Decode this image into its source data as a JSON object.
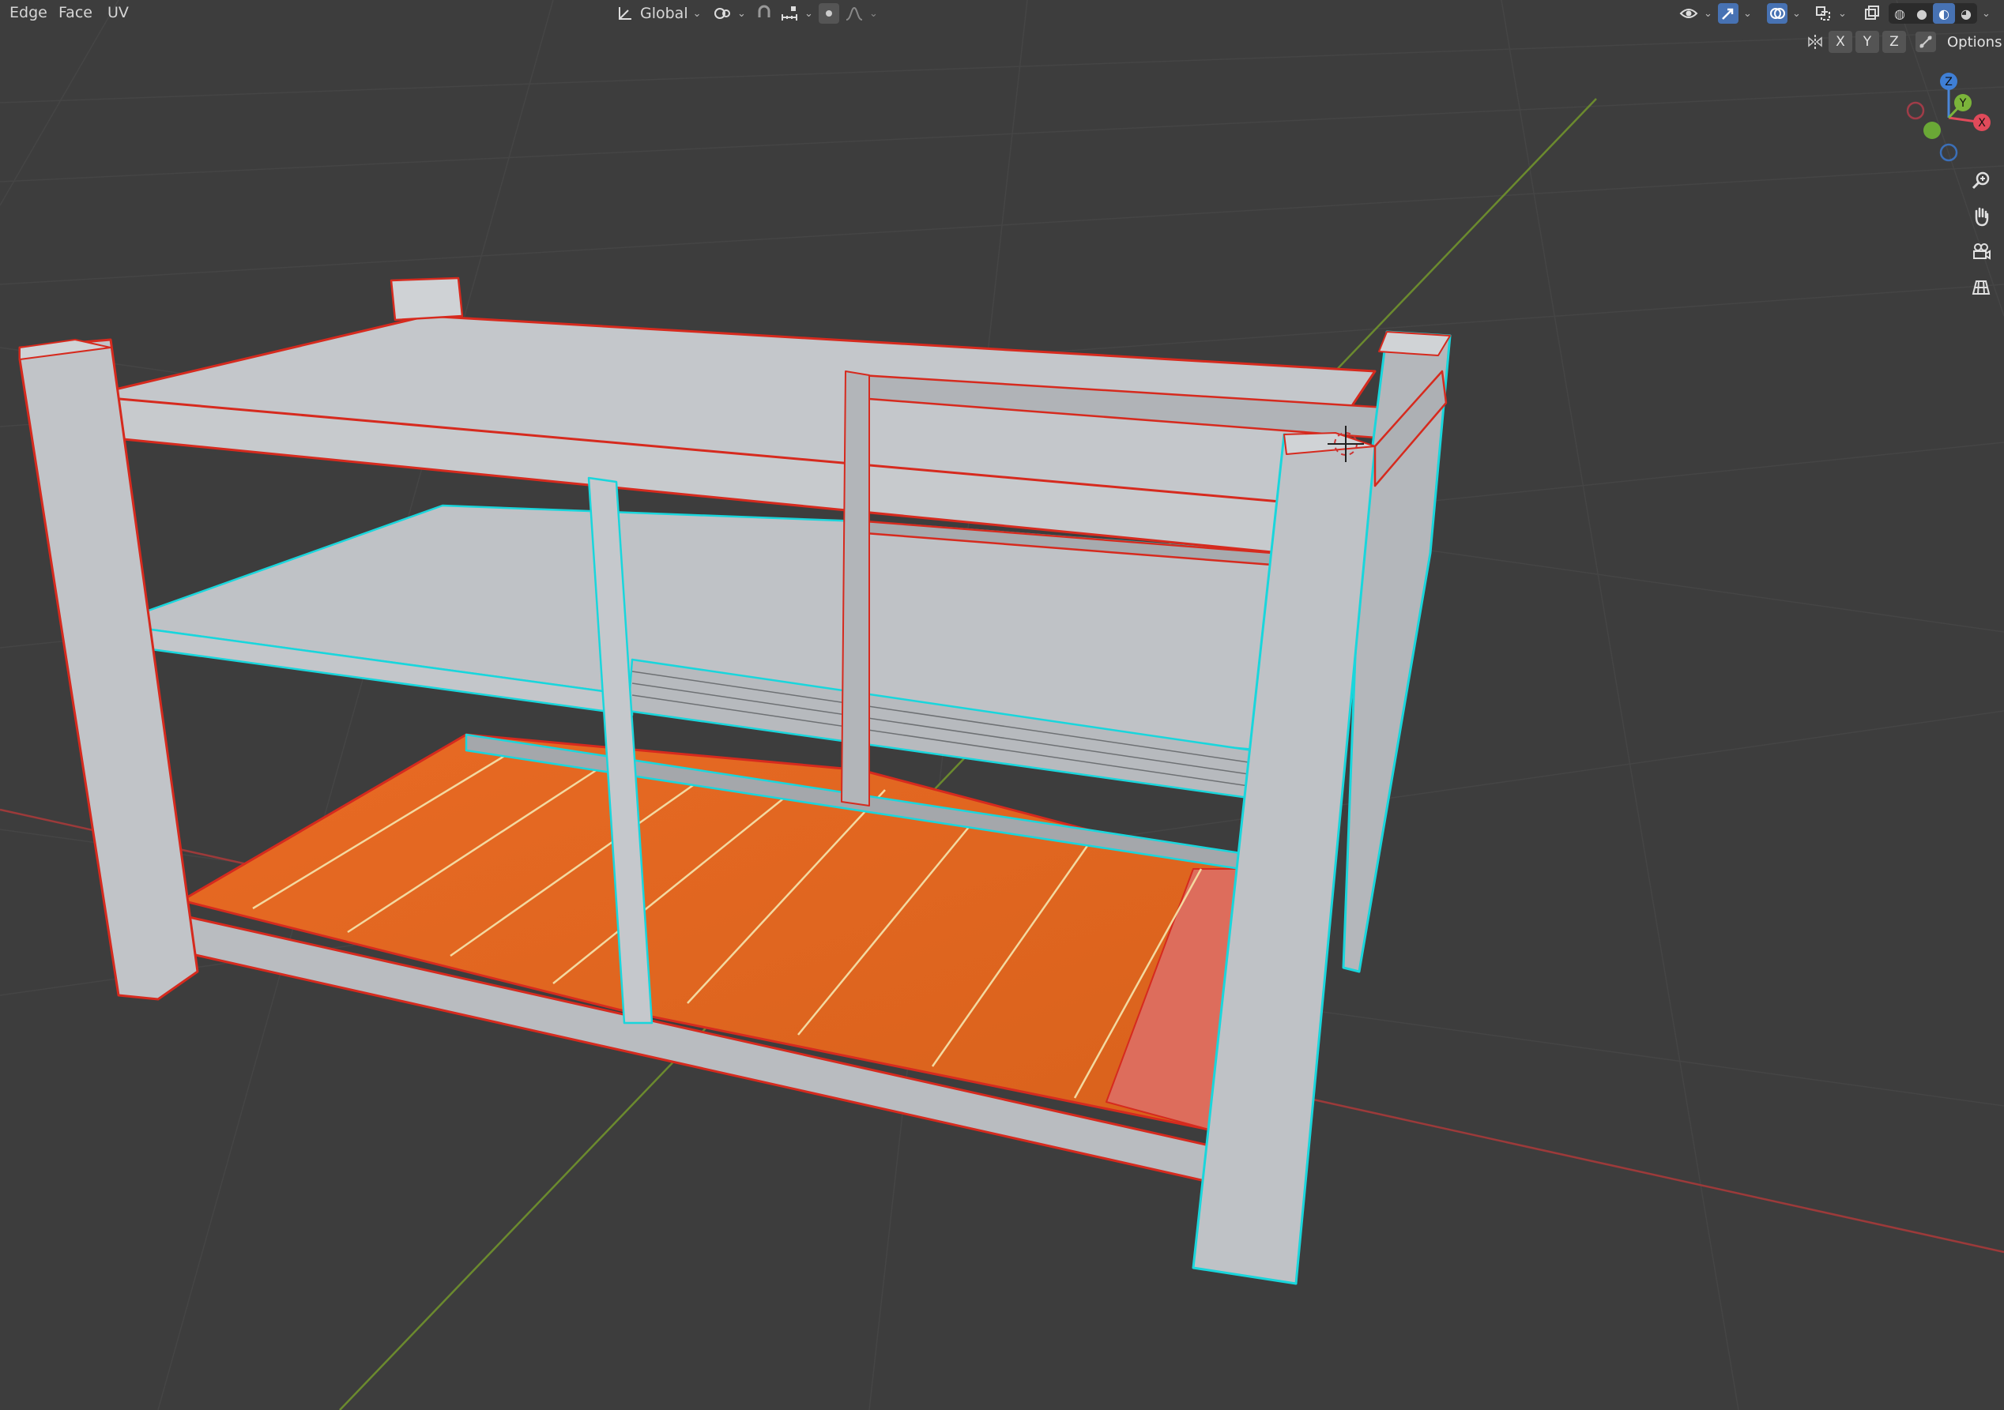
{
  "menu": {
    "edge": "Edge",
    "face": "Face",
    "uv": "UV"
  },
  "header": {
    "orientation_label": "Global",
    "options_label": "Options"
  },
  "axes": {
    "x": "X",
    "y": "Y",
    "z": "Z"
  },
  "gizmo": {
    "x": "X",
    "y": "Y",
    "z": "Z"
  },
  "icons": {
    "orientation": "transform-orientation-icon",
    "pivot": "pivot-point-icon",
    "snap": "snap-magnet-icon",
    "snap_target": "snap-increment-icon",
    "proportional": "proportional-edit-icon",
    "falloff": "falloff-curve-icon",
    "visibility": "object-visibility-icon",
    "gizmo": "gizmo-toggle-icon",
    "overlays": "overlays-icon",
    "xray": "xray-icon",
    "mirror": "mesh-symmetry-icon",
    "zoom": "zoom-icon",
    "pan": "pan-hand-icon",
    "camera": "camera-view-icon",
    "ortho": "ortho-grid-icon"
  },
  "colors": {
    "background": "#3d3d3d",
    "selected_face": "#e0661f",
    "active_face": "#dd6d5c",
    "edge_select": "#ff2a1a",
    "seam_cyan": "#19d6dc",
    "x_axis": "#b03a3a",
    "y_axis": "#6b9a2e",
    "accent": "#4772b3"
  }
}
